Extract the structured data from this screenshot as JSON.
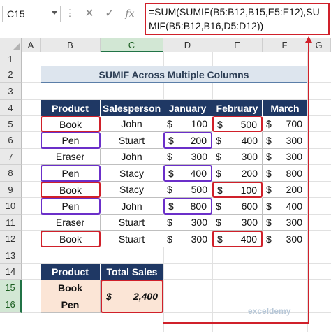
{
  "name_box": "C15",
  "formula": "=SUM(SUMIF(B5:B12,B15,E5:E12),SUMIF(B5:B12,B16,D5:D12))",
  "fx_label": "fx",
  "columns": [
    "A",
    "B",
    "C",
    "D",
    "E",
    "F",
    "G"
  ],
  "rows": [
    "1",
    "2",
    "3",
    "4",
    "5",
    "6",
    "7",
    "8",
    "9",
    "10",
    "11",
    "12",
    "13",
    "14",
    "15",
    "16"
  ],
  "title": "SUMIF Across Multiple Columns",
  "headers": [
    "Product",
    "Salesperson",
    "January",
    "February",
    "March"
  ],
  "data": [
    {
      "product": "Book",
      "sales": "John",
      "jan": "100",
      "feb": "500",
      "mar": "700"
    },
    {
      "product": "Pen",
      "sales": "Stuart",
      "jan": "200",
      "feb": "400",
      "mar": "300"
    },
    {
      "product": "Eraser",
      "sales": "John",
      "jan": "300",
      "feb": "300",
      "mar": "300"
    },
    {
      "product": "Pen",
      "sales": "Stacy",
      "jan": "400",
      "feb": "200",
      "mar": "800"
    },
    {
      "product": "Book",
      "sales": "Stacy",
      "jan": "500",
      "feb": "100",
      "mar": "200"
    },
    {
      "product": "Pen",
      "sales": "John",
      "jan": "800",
      "feb": "600",
      "mar": "400"
    },
    {
      "product": "Eraser",
      "sales": "Stuart",
      "jan": "300",
      "feb": "300",
      "mar": "300"
    },
    {
      "product": "Book",
      "sales": "Stuart",
      "jan": "300",
      "feb": "400",
      "mar": "300"
    }
  ],
  "currency": "$",
  "summary": {
    "headers": [
      "Product",
      "Total Sales"
    ],
    "products": [
      "Book",
      "Pen"
    ],
    "total": "2,400"
  },
  "watermark": "exceldemy",
  "colors": {
    "header_bg": "#1f3864",
    "highlight_red": "#d0202a",
    "highlight_purple": "#6b2fc9",
    "result_bg": "#fbe5d6"
  }
}
